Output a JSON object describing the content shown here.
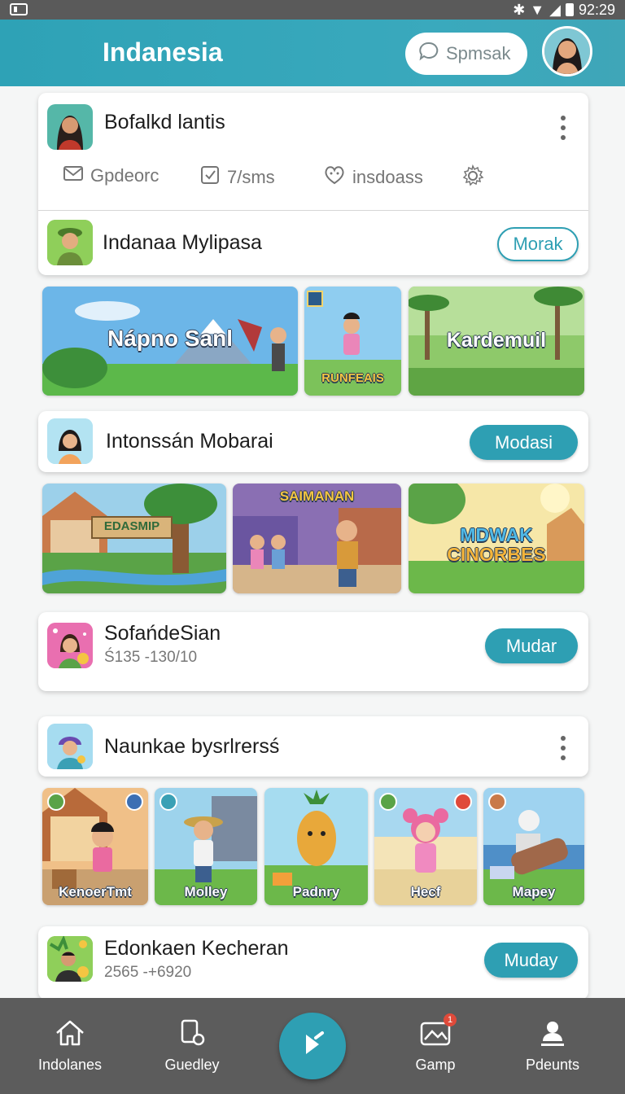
{
  "status_bar": {
    "time": "92:29"
  },
  "app_bar": {
    "title": "Indanesia",
    "search_label": "Spmsak"
  },
  "profile_card": {
    "name": "Bofalkd lantis",
    "stats": [
      {
        "icon": "mail-icon",
        "label": "Gpdeorc"
      },
      {
        "icon": "checklist-icon",
        "label": "7/sms"
      },
      {
        "icon": "face-icon",
        "label": "insdoass"
      },
      {
        "icon": "gear-icon",
        "label": ""
      }
    ],
    "featured": {
      "title": "Indanaa Mylipasa",
      "button": "Morak"
    }
  },
  "banners_1": [
    {
      "label": "Nápno Sanl"
    },
    {
      "label": "RUNFEAIS"
    },
    {
      "label": "Kardemuil"
    }
  ],
  "section_2": {
    "title": "Intonssán Mobarai",
    "button": "Modasi"
  },
  "banners_2": [
    {
      "label": "EDASMIP"
    },
    {
      "label": "SAIMANAN"
    },
    {
      "label_line1": "MDWAK",
      "label_line2": "CINORBES"
    }
  ],
  "section_3": {
    "title": "SofańdeSian",
    "subtitle": "Ś135 -130/10",
    "button": "Mudar"
  },
  "section_4": {
    "title": "Naunkae bysrlrersś"
  },
  "characters": [
    {
      "label": "KenoerTmt"
    },
    {
      "label": "Molley"
    },
    {
      "label": "Padnry"
    },
    {
      "label": "Hecf"
    },
    {
      "label": "Mapey"
    }
  ],
  "section_5": {
    "title": "Edonkaen Kecheran",
    "subtitle": "2565 -+6920",
    "button": "Muday"
  },
  "bottom_nav": {
    "items": [
      {
        "label": "Indolanes",
        "icon": "home-icon"
      },
      {
        "label": "Guedley",
        "icon": "device-icon"
      },
      {
        "label": "",
        "icon": "play-icon"
      },
      {
        "label": "Gamp",
        "icon": "gallery-icon",
        "badge": "1"
      },
      {
        "label": "Pdeunts",
        "icon": "person-icon"
      }
    ]
  },
  "colors": {
    "primary": "#2e9fb3",
    "nav": "#5c5c5c",
    "status": "#5a5a5a"
  }
}
